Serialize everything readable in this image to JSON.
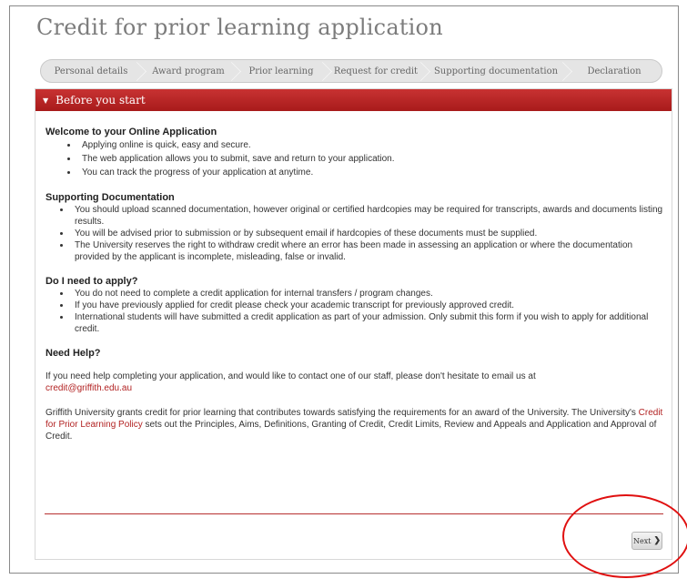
{
  "page": {
    "title": "Credit for prior learning application"
  },
  "steps": [
    {
      "label": "Personal details"
    },
    {
      "label": "Award program"
    },
    {
      "label": "Prior learning"
    },
    {
      "label": "Request for credit"
    },
    {
      "label": "Supporting documentation"
    },
    {
      "label": "Declaration"
    }
  ],
  "section": {
    "title": "Before you start",
    "welcome": {
      "heading": "Welcome to your Online Application",
      "items": [
        "Applying online is quick, easy and secure.",
        "The web application allows you to submit, save and return to your application.",
        "You can track the progress of your application at anytime."
      ]
    },
    "supporting": {
      "heading": "Supporting Documentation",
      "items": [
        "You should upload scanned documentation, however original or certified hardcopies may be required for transcripts, awards and documents listing results.",
        "You will be advised prior to submission or by subsequent email if hardcopies of these documents must be supplied.",
        "The University reserves the right to withdraw credit where an error has been made in assessing an application or where the documentation provided by the applicant is incomplete, misleading, false or invalid."
      ]
    },
    "apply": {
      "heading": "Do I need to apply?",
      "items": [
        "You do not need to complete a credit application for internal transfers / program changes.",
        "If you have previously applied for credit please check your academic transcript for previously approved credit.",
        "International students will have submitted a credit application as part of your admission. Only submit this form if you wish to apply for additional credit."
      ]
    },
    "help": {
      "heading": "Need Help?",
      "text": "If you need help completing your application, and would like to contact one of our staff, please don't hesitate to email us at",
      "email": "credit@griffith.edu.au"
    },
    "policy": {
      "text_before": "Griffith University grants credit for prior learning that contributes towards satisfying the requirements for an award of the University.    The University's ",
      "link": "Credit for Prior Learning Policy",
      "text_after": " sets out the Principles, Aims, Definitions, Granting of Credit, Credit Limits, Review and Appeals and Application and Approval of Credit."
    }
  },
  "buttons": {
    "next": "Next"
  },
  "colors": {
    "accent": "#b22222",
    "banner": "#b52424",
    "annotation": "#e01010"
  }
}
